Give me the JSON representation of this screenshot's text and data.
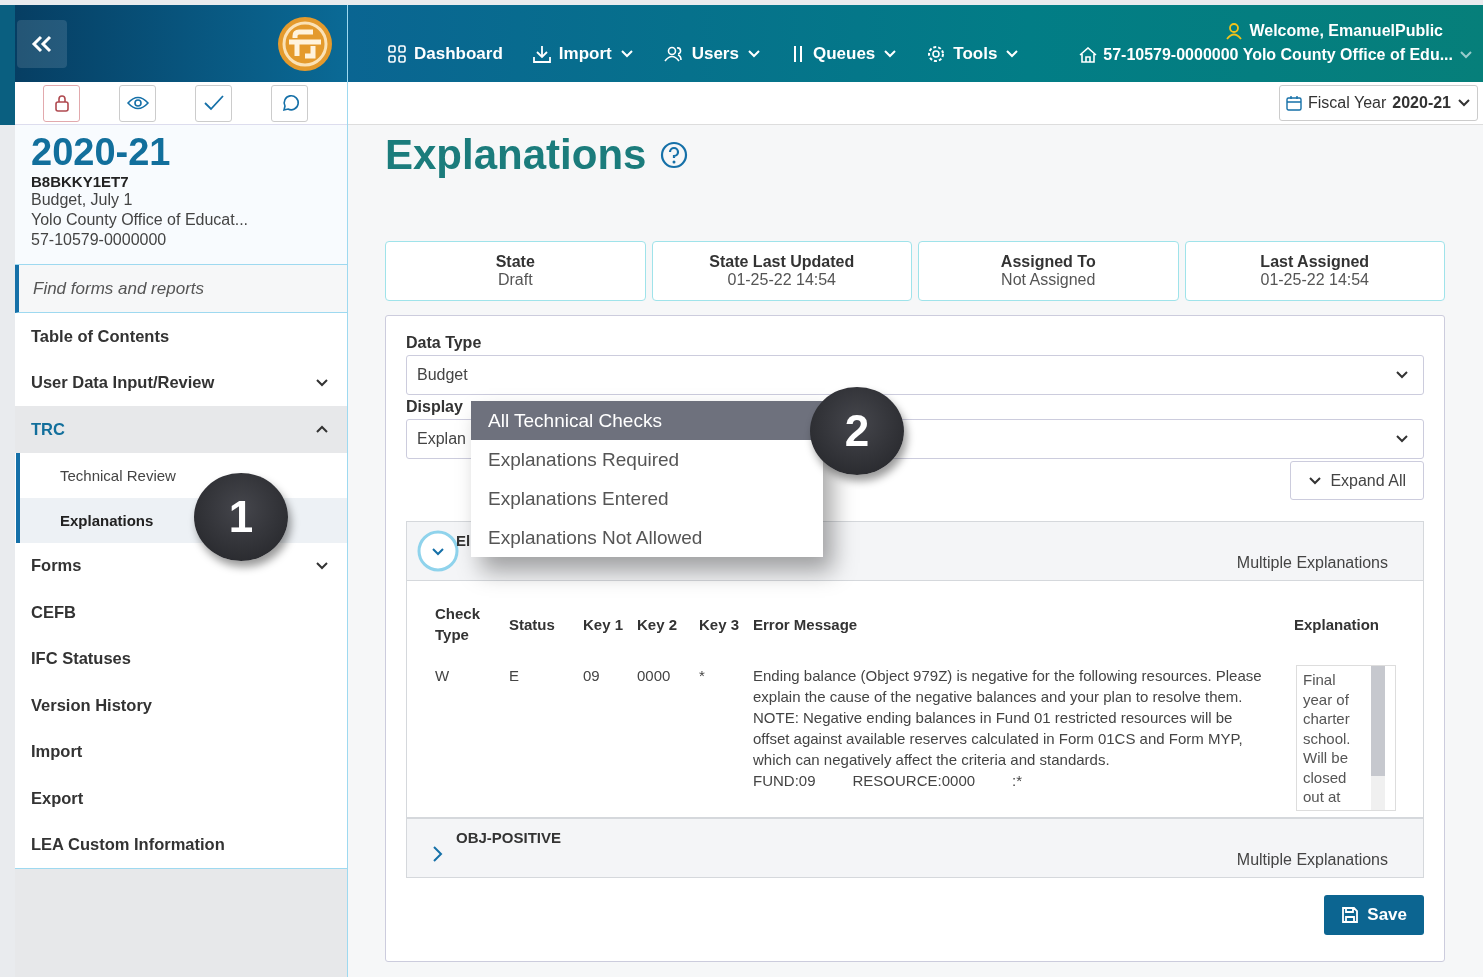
{
  "header": {
    "welcome": "Welcome, EmanuelPublic",
    "organization": "57-10579-0000000 Yolo County Office of Edu...",
    "nav": [
      {
        "label": "Dashboard",
        "caret": false
      },
      {
        "label": "Import",
        "caret": true
      },
      {
        "label": "Users",
        "caret": true
      },
      {
        "label": "Queues",
        "caret": true
      },
      {
        "label": "Tools",
        "caret": true
      }
    ]
  },
  "sidebar": {
    "year": "2020-21",
    "code": "B8BKKY1ET7",
    "lines": [
      "Budget, July 1",
      "Yolo County Office of Educat...",
      "57-10579-0000000"
    ],
    "search": {
      "placeholder": "Find forms and reports"
    },
    "items": [
      {
        "label": "Table of Contents",
        "kind": "link",
        "selected": false
      },
      {
        "label": "User Data Input/Review",
        "kind": "group",
        "expanded": false,
        "selected": false
      },
      {
        "label": "TRC",
        "kind": "group",
        "expanded": true,
        "selected": true,
        "children": [
          {
            "label": "Technical Review",
            "selected": false
          },
          {
            "label": "Explanations",
            "selected": true
          }
        ]
      },
      {
        "label": "Forms",
        "kind": "group",
        "expanded": false,
        "selected": false
      },
      {
        "label": "CEFB",
        "kind": "link",
        "selected": false
      },
      {
        "label": "IFC Statuses",
        "kind": "link",
        "selected": false
      },
      {
        "label": "Version History",
        "kind": "link",
        "selected": false
      },
      {
        "label": "Import",
        "kind": "link",
        "selected": false
      },
      {
        "label": "Export",
        "kind": "link",
        "selected": false
      },
      {
        "label": "LEA Custom Information",
        "kind": "link",
        "selected": false
      }
    ]
  },
  "fiscal_year": {
    "label": "Fiscal Year",
    "value": "2020-21"
  },
  "page_title": "Explanations",
  "status_cards": [
    {
      "label": "State",
      "value": "Draft"
    },
    {
      "label": "State Last Updated",
      "value": "01-25-22 14:54"
    },
    {
      "label": "Assigned To",
      "value": "Not Assigned"
    },
    {
      "label": "Last Assigned",
      "value": "01-25-22 14:54"
    }
  ],
  "data_type": {
    "label": "Data Type",
    "value": "Budget"
  },
  "display": {
    "label": "Display",
    "value": "Explan",
    "options": [
      {
        "label": "All Technical Checks",
        "selected": true
      },
      {
        "label": "Explanations Required",
        "selected": false
      },
      {
        "label": "Explanations Entered",
        "selected": false
      },
      {
        "label": "Explanations Not Allowed",
        "selected": false
      }
    ]
  },
  "expand_all": "Expand All",
  "sections": [
    {
      "title": "El",
      "note": "Multiple Explanations",
      "expanded": true,
      "columns": [
        "Check Type",
        "Status",
        "Key 1",
        "Key 2",
        "Key 3",
        "Error Message",
        "Explanation"
      ],
      "rows": [
        {
          "cells": [
            "W",
            "E",
            "09",
            "0000",
            "*"
          ],
          "message": "Ending balance (Object 979Z) is negative for the following resources. Please explain the cause of the negative balances and your plan to resolve them. NOTE: Negative ending balances in Fund 01 restricted resources will be offset against available reserves calculated in Form 01CS and Form MYP, which can negatively affect the criteria and standards.",
          "fields": [
            "FUND:09",
            "RESOURCE:0000",
            ":*"
          ],
          "explanation": "Final year of charter school. Will be closed out at"
        }
      ]
    },
    {
      "title": "OBJ-POSITIVE",
      "note": "Multiple Explanations",
      "expanded": false
    }
  ],
  "save": "Save",
  "callouts": [
    "1",
    "2"
  ]
}
